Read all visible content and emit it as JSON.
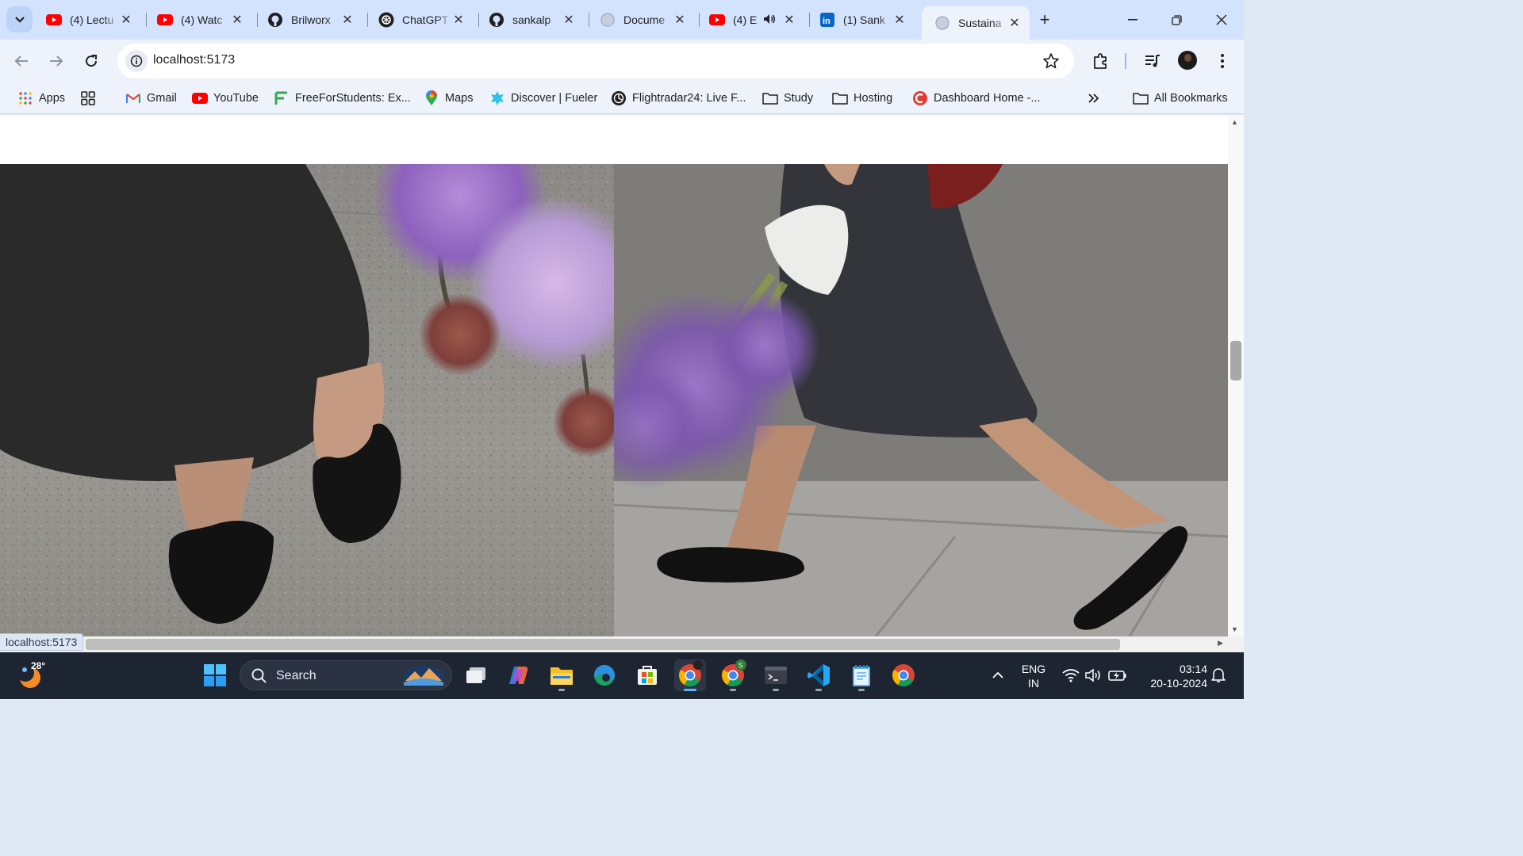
{
  "tabs": [
    {
      "title": "(4) Lectu",
      "icon": "youtube-icon"
    },
    {
      "title": "(4) Watc",
      "icon": "youtube-icon"
    },
    {
      "title": "Brilworx",
      "icon": "github-icon"
    },
    {
      "title": "ChatGPT",
      "icon": "chatgpt-icon"
    },
    {
      "title": "sankalp",
      "icon": "github-icon"
    },
    {
      "title": "Docume",
      "icon": "globe-icon"
    },
    {
      "title": "(4) E",
      "icon": "youtube-icon",
      "audio": true
    },
    {
      "title": "(1) Sank",
      "icon": "linkedin-icon"
    },
    {
      "title": "Sustaina",
      "icon": "globe-icon",
      "active": true
    }
  ],
  "address_bar": {
    "url": "localhost:5173"
  },
  "bookmarks": [
    {
      "label": "Apps",
      "icon": "apps-grid-icon"
    },
    {
      "label": "",
      "icon": "tab-groups-icon"
    },
    {
      "label": "Gmail",
      "icon": "gmail-icon"
    },
    {
      "label": "YouTube",
      "icon": "youtube-icon"
    },
    {
      "label": "FreeForStudents: Ex...",
      "icon": "freeforstudents-icon"
    },
    {
      "label": "Maps",
      "icon": "maps-pin-icon"
    },
    {
      "label": "Discover | Fueler",
      "icon": "fueler-icon"
    },
    {
      "label": "Flightradar24: Live F...",
      "icon": "flightradar-icon"
    },
    {
      "label": "Study",
      "icon": "folder-icon"
    },
    {
      "label": "Hosting",
      "icon": "folder-icon"
    },
    {
      "label": "Dashboard Home -...",
      "icon": "dashboard-icon"
    },
    {
      "label": "All Bookmarks",
      "icon": "folder-icon"
    }
  ],
  "status_bar": {
    "url": "localhost:5173"
  },
  "taskbar": {
    "weather_temp": "28°",
    "search_placeholder": "Search",
    "language_line1": "ENG",
    "language_line2": "IN",
    "time": "03:14",
    "date": "20-10-2024"
  },
  "colors": {
    "tabstrip": "#d3e3fd",
    "toolbar": "#eef3fb",
    "taskbar": "#1e2532",
    "accent": "#0b57d0"
  }
}
